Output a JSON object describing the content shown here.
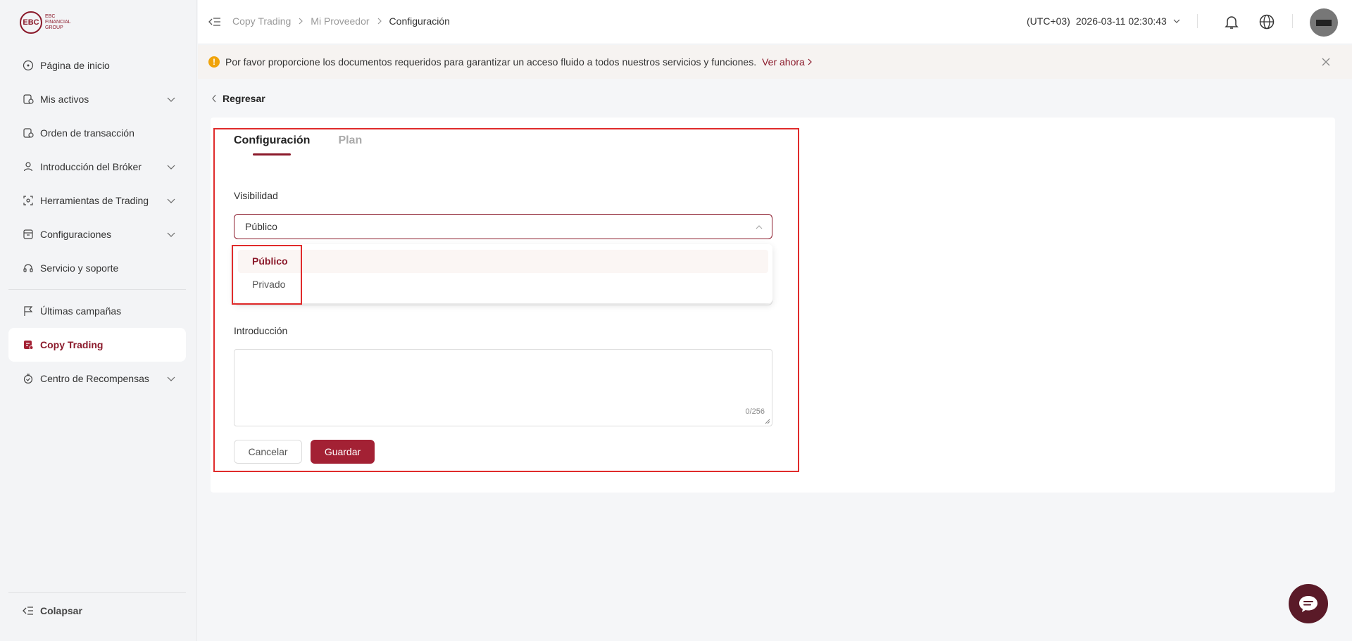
{
  "brand": {
    "logo_letters": "EBC",
    "logo_line1": "EBC",
    "logo_line2": "FINANCIAL",
    "logo_line3": "GROUP",
    "accent": "#8b1a2b"
  },
  "sidebar": {
    "items": [
      {
        "label": "Página de inicio",
        "icon": "home-icon",
        "expandable": false
      },
      {
        "label": "Mis activos",
        "icon": "assets-icon",
        "expandable": true
      },
      {
        "label": "Orden de transacción",
        "icon": "order-icon",
        "expandable": false
      },
      {
        "label": "Introducción del Bróker",
        "icon": "broker-icon",
        "expandable": true
      },
      {
        "label": "Herramientas de Trading",
        "icon": "tools-icon",
        "expandable": true
      },
      {
        "label": "Configuraciones",
        "icon": "settings-icon",
        "expandable": true
      },
      {
        "label": "Servicio y soporte",
        "icon": "headset-icon",
        "expandable": false
      },
      {
        "label": "Últimas campañas",
        "icon": "flag-icon",
        "expandable": false
      },
      {
        "label": "Copy Trading",
        "icon": "copy-trading-icon",
        "expandable": false,
        "active": true
      },
      {
        "label": "Centro de Recompensas",
        "icon": "rewards-icon",
        "expandable": true
      }
    ],
    "collapse_label": "Colapsar"
  },
  "header": {
    "breadcrumb": [
      "Copy Trading",
      "Mi Proveedor",
      "Configuración"
    ],
    "timezone": "(UTC+03)",
    "datetime": "2026-03-11 02:30:43"
  },
  "notice": {
    "text": "Por favor proporcione los documentos requeridos para garantizar un acceso fluido a todos nuestros servicios y funciones.",
    "link": "Ver ahora"
  },
  "back_label": "Regresar",
  "tabs": [
    {
      "label": "Configuración",
      "active": true
    },
    {
      "label": "Plan",
      "active": false
    }
  ],
  "form": {
    "visibility_label": "Visibilidad",
    "visibility_value": "Público",
    "visibility_options": [
      "Público",
      "Privado"
    ],
    "intro_label": "Introducción",
    "intro_value": "",
    "intro_counter": "0/256",
    "cancel_label": "Cancelar",
    "save_label": "Guardar"
  }
}
